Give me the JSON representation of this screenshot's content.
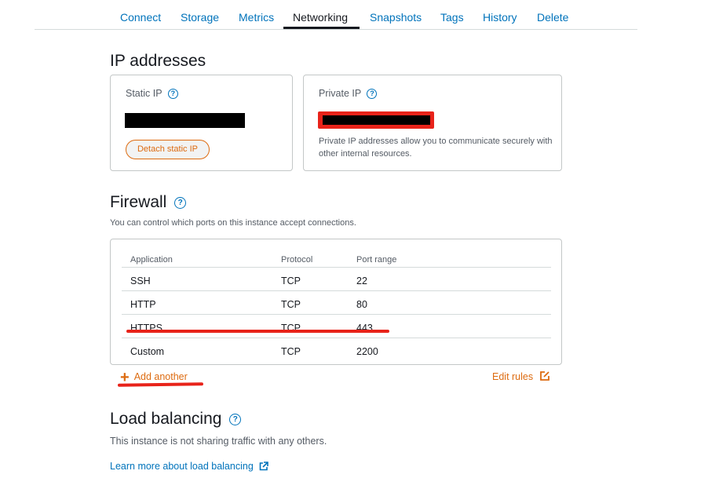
{
  "tabs": [
    {
      "label": "Connect"
    },
    {
      "label": "Storage"
    },
    {
      "label": "Metrics"
    },
    {
      "label": "Networking",
      "active": true
    },
    {
      "label": "Snapshots"
    },
    {
      "label": "Tags"
    },
    {
      "label": "History"
    },
    {
      "label": "Delete"
    }
  ],
  "ip_section": {
    "heading": "IP addresses",
    "static_ip": {
      "label": "Static IP",
      "detach_button": "Detach static IP"
    },
    "private_ip": {
      "label": "Private IP",
      "note": "Private IP addresses allow you to communicate securely with other internal resources."
    }
  },
  "firewall": {
    "heading": "Firewall",
    "description": "You can control which ports on this instance accept connections.",
    "columns": [
      "Application",
      "Protocol",
      "Port range"
    ],
    "rows": [
      {
        "application": "SSH",
        "protocol": "TCP",
        "port_range": "22"
      },
      {
        "application": "HTTP",
        "protocol": "TCP",
        "port_range": "80"
      },
      {
        "application": "HTTPS",
        "protocol": "TCP",
        "port_range": "443"
      },
      {
        "application": "Custom",
        "protocol": "TCP",
        "port_range": "2200"
      }
    ],
    "add_another": "Add another",
    "edit_rules": "Edit rules"
  },
  "load_balancing": {
    "heading": "Load balancing",
    "description": "This instance is not sharing traffic with any others.",
    "learn_more": "Learn more about load balancing"
  },
  "colors": {
    "link": "#0073bb",
    "accent": "#dd6b10",
    "annotation": "#e8231a"
  },
  "icons": {
    "help": "question-circle-icon",
    "plus": "plus-icon",
    "edit": "edit-square-icon",
    "external": "external-link-icon"
  }
}
